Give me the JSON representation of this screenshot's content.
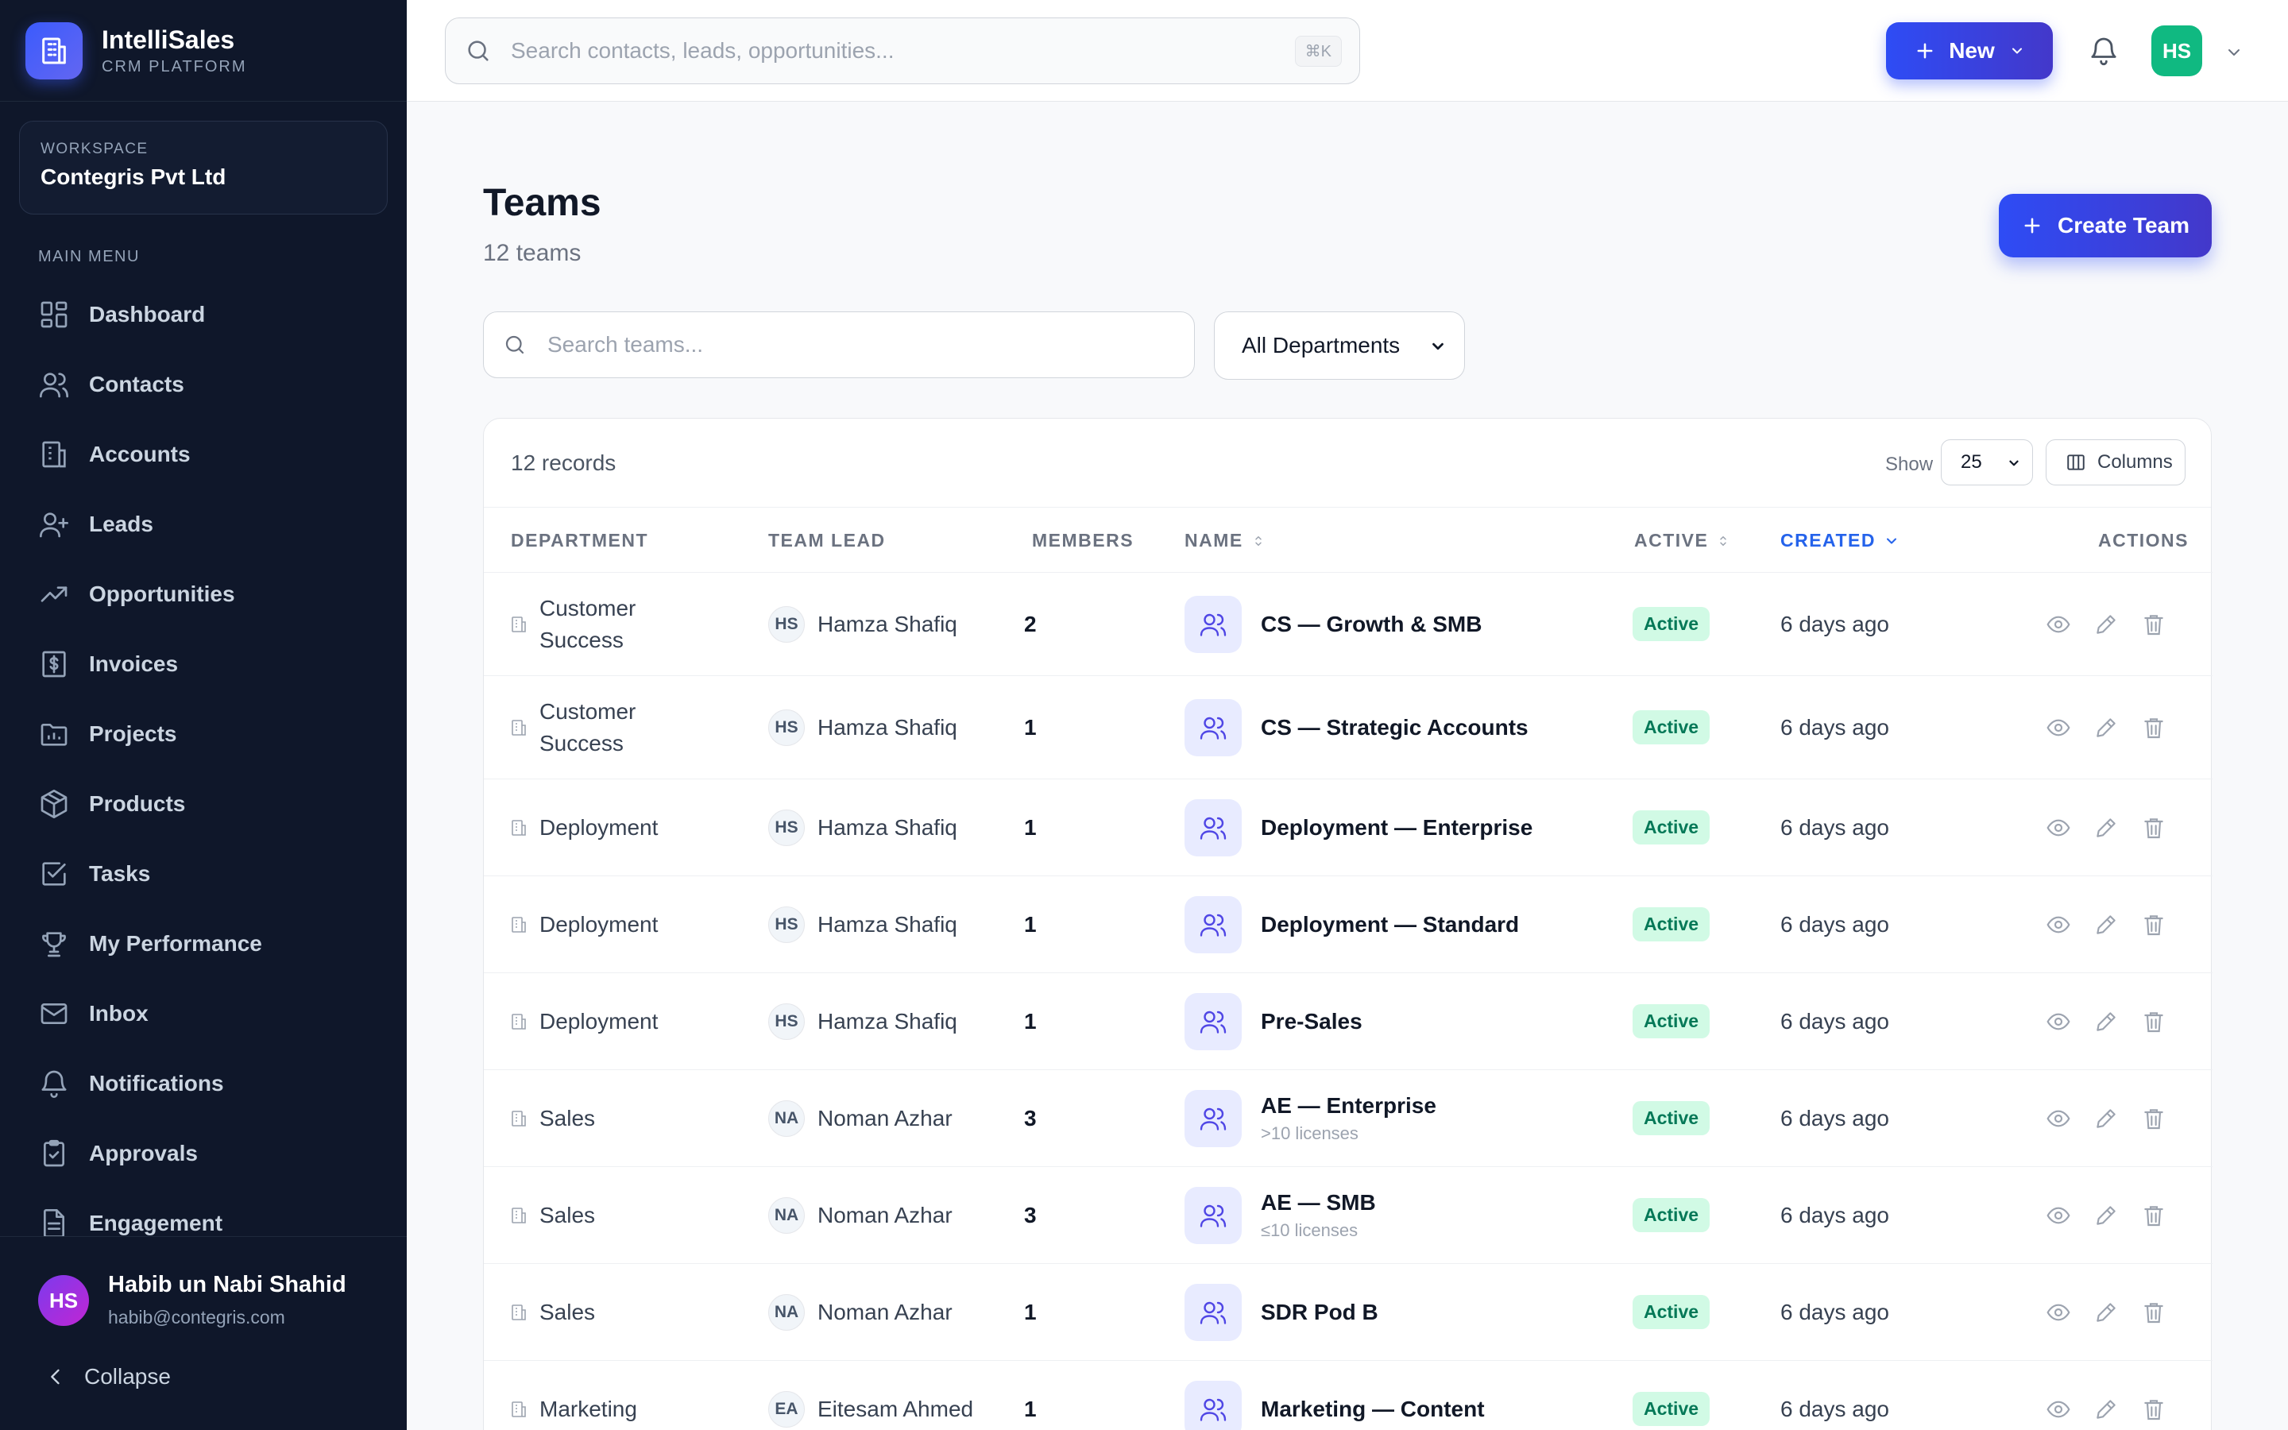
{
  "brand": {
    "name": "IntelliSales",
    "subtitle": "CRM PLATFORM"
  },
  "workspace": {
    "label": "WORKSPACE",
    "name": "Contegris Pvt Ltd"
  },
  "sidebar": {
    "menu_label": "MAIN MENU",
    "items": [
      {
        "label": "Dashboard",
        "icon": "dashboard-icon"
      },
      {
        "label": "Contacts",
        "icon": "users-icon"
      },
      {
        "label": "Accounts",
        "icon": "building-icon"
      },
      {
        "label": "Leads",
        "icon": "user-plus-icon"
      },
      {
        "label": "Opportunities",
        "icon": "trending-up-icon"
      },
      {
        "label": "Invoices",
        "icon": "dollar-icon"
      },
      {
        "label": "Projects",
        "icon": "folder-icon"
      },
      {
        "label": "Products",
        "icon": "package-icon"
      },
      {
        "label": "Tasks",
        "icon": "checkbox-icon"
      },
      {
        "label": "My Performance",
        "icon": "trophy-icon"
      },
      {
        "label": "Inbox",
        "icon": "mail-icon"
      },
      {
        "label": "Notifications",
        "icon": "bell-icon"
      },
      {
        "label": "Approvals",
        "icon": "clipboard-check-icon"
      },
      {
        "label": "Engagement",
        "icon": "document-icon"
      }
    ],
    "user": {
      "initials": "HS",
      "name": "Habib un Nabi Shahid",
      "email": "habib@contegris.com"
    },
    "collapse_label": "Collapse"
  },
  "topbar": {
    "search_placeholder": "Search contacts, leads, opportunities...",
    "shortcut": "⌘K",
    "new_label": "New",
    "avatar_initials": "HS"
  },
  "page": {
    "title": "Teams",
    "subtitle": "12 teams",
    "create_label": "Create Team",
    "search_placeholder": "Search teams...",
    "department_filter": "All Departments"
  },
  "table": {
    "records_label": "12 records",
    "show_label": "Show",
    "page_size": "25",
    "columns_label": "Columns",
    "headers": {
      "department": "DEPARTMENT",
      "team_lead": "TEAM LEAD",
      "members": "MEMBERS",
      "name": "NAME",
      "active": "ACTIVE",
      "created": "CREATED",
      "actions": "ACTIONS"
    },
    "rows": [
      {
        "department": "Customer Success",
        "lead_initials": "HS",
        "lead": "Hamza Shafiq",
        "members": "2",
        "name": "CS — Growth & SMB",
        "sub": "",
        "status": "Active",
        "created": "6 days ago"
      },
      {
        "department": "Customer Success",
        "lead_initials": "HS",
        "lead": "Hamza Shafiq",
        "members": "1",
        "name": "CS — Strategic Accounts",
        "sub": "",
        "status": "Active",
        "created": "6 days ago"
      },
      {
        "department": "Deployment",
        "lead_initials": "HS",
        "lead": "Hamza Shafiq",
        "members": "1",
        "name": "Deployment — Enterprise",
        "sub": "",
        "status": "Active",
        "created": "6 days ago"
      },
      {
        "department": "Deployment",
        "lead_initials": "HS",
        "lead": "Hamza Shafiq",
        "members": "1",
        "name": "Deployment — Standard",
        "sub": "",
        "status": "Active",
        "created": "6 days ago"
      },
      {
        "department": "Deployment",
        "lead_initials": "HS",
        "lead": "Hamza Shafiq",
        "members": "1",
        "name": "Pre-Sales",
        "sub": "",
        "status": "Active",
        "created": "6 days ago"
      },
      {
        "department": "Sales",
        "lead_initials": "NA",
        "lead": "Noman Azhar",
        "members": "3",
        "name": "AE — Enterprise",
        "sub": ">10 licenses",
        "status": "Active",
        "created": "6 days ago"
      },
      {
        "department": "Sales",
        "lead_initials": "NA",
        "lead": "Noman Azhar",
        "members": "3",
        "name": "AE — SMB",
        "sub": "≤10 licenses",
        "status": "Active",
        "created": "6 days ago"
      },
      {
        "department": "Sales",
        "lead_initials": "NA",
        "lead": "Noman Azhar",
        "members": "1",
        "name": "SDR Pod B",
        "sub": "",
        "status": "Active",
        "created": "6 days ago"
      },
      {
        "department": "Marketing",
        "lead_initials": "EA",
        "lead": "Eitesam Ahmed",
        "members": "1",
        "name": "Marketing — Content",
        "sub": "",
        "status": "Active",
        "created": "6 days ago"
      }
    ]
  }
}
